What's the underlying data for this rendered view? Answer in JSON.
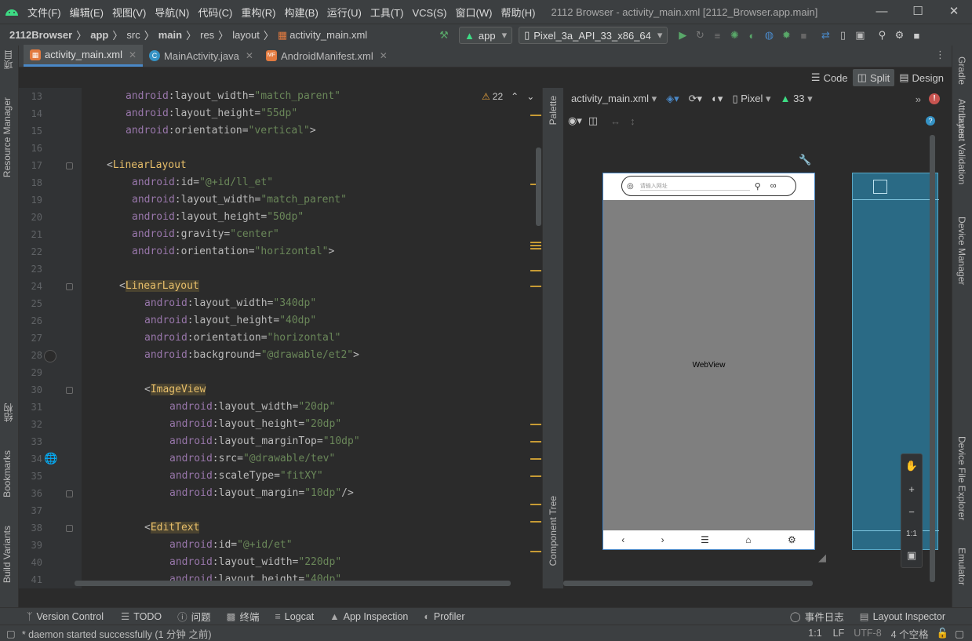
{
  "titlebar": {
    "menu": [
      "文件(F)",
      "编辑(E)",
      "视图(V)",
      "导航(N)",
      "代码(C)",
      "重构(R)",
      "构建(B)",
      "运行(U)",
      "工具(T)",
      "VCS(S)",
      "窗口(W)",
      "帮助(H)"
    ],
    "window_title": "2112 Browser - activity_main.xml [2112_Browser.app.main]"
  },
  "breadcrumb": {
    "project": "2112Browser",
    "module": "app",
    "p1": "src",
    "p2": "main",
    "p3": "res",
    "p4": "layout",
    "file": "activity_main.xml"
  },
  "run": {
    "config": "app",
    "device": "Pixel_3a_API_33_x86_64"
  },
  "tabs": [
    {
      "label": "activity_main.xml"
    },
    {
      "label": "MainActivity.java"
    },
    {
      "label": "AndroidManifest.xml"
    }
  ],
  "modes": {
    "code": "Code",
    "split": "Split",
    "design": "Design"
  },
  "inspection": {
    "warnings": "22"
  },
  "left_tools": {
    "project": "项目",
    "resource_manager": "Resource Manager",
    "structure": "结构",
    "bookmarks": "Bookmarks",
    "build_variants": "Build Variants"
  },
  "right_tools": {
    "gradle": "Gradle",
    "attributes": "Attributes",
    "layout_validation": "Layout Validation",
    "device_manager": "Device Manager",
    "device_file_explorer": "Device File Explorer",
    "emulator": "Emulator"
  },
  "design": {
    "file": "activity_main.xml",
    "device": "Pixel",
    "api": "33",
    "palette": "Palette",
    "component_tree": "Component Tree",
    "search_hint": "请输入网址",
    "webview_label": "WebView",
    "zoom_ratio": "1:1"
  },
  "code_lines": {
    "numbers": [
      "13",
      "14",
      "15",
      "16",
      "17",
      "18",
      "19",
      "20",
      "21",
      "22",
      "23",
      "24",
      "25",
      "26",
      "27",
      "28",
      "29",
      "30",
      "31",
      "32",
      "33",
      "34",
      "35",
      "36",
      "37",
      "38",
      "39",
      "40",
      "41"
    ]
  },
  "bottom_tools": [
    "Version Control",
    "TODO",
    "问题",
    "终端",
    "Logcat",
    "App Inspection",
    "Profiler"
  ],
  "bottom_right_tools": [
    "事件日志",
    "Layout Inspector"
  ],
  "status": {
    "message": "* daemon started successfully (1 分钟 之前)",
    "position": "1:1",
    "line_sep": "LF",
    "encoding": "UTF-8",
    "indent": "4 个空格"
  },
  "colors": {
    "accent": "#4a88c7",
    "attr_ns": "#9876aa",
    "value": "#6a8759",
    "tag": "#e8bf6a",
    "warning": "#e8a33d"
  }
}
